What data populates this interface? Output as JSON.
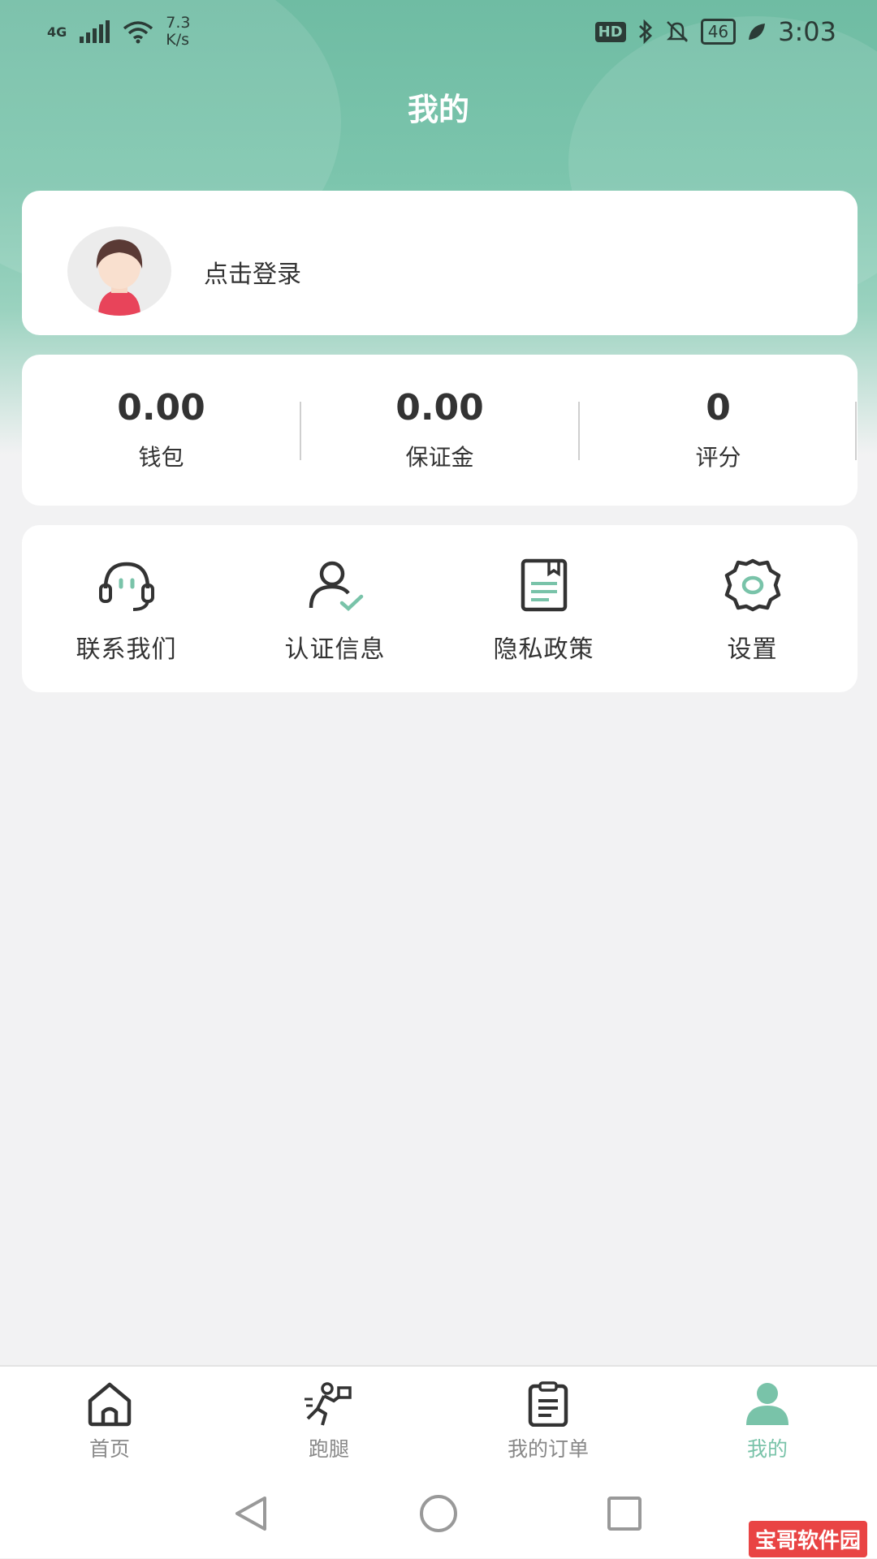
{
  "status_bar": {
    "network": "4G",
    "speed_value": "7.3",
    "speed_unit": "K/s",
    "hd_badge": "HD",
    "battery": "46",
    "time": "3:03"
  },
  "header": {
    "title": "我的"
  },
  "profile": {
    "login_label": "点击登录"
  },
  "stats": [
    {
      "value": "0.00",
      "label": "钱包"
    },
    {
      "value": "0.00",
      "label": "保证金"
    },
    {
      "value": "0",
      "label": "评分"
    }
  ],
  "menu": [
    {
      "label": "联系我们",
      "icon": "headset-icon"
    },
    {
      "label": "认证信息",
      "icon": "user-check-icon"
    },
    {
      "label": "隐私政策",
      "icon": "document-icon"
    },
    {
      "label": "设置",
      "icon": "gear-icon"
    }
  ],
  "tabs": [
    {
      "label": "首页",
      "icon": "home-icon"
    },
    {
      "label": "跑腿",
      "icon": "runner-icon"
    },
    {
      "label": "我的订单",
      "icon": "clipboard-icon"
    },
    {
      "label": "我的",
      "icon": "person-icon",
      "active": true
    }
  ],
  "watermark": "宝哥软件园",
  "colors": {
    "accent": "#79c3a9",
    "header": "#6fbca3",
    "avatar_shirt": "#e8445a"
  }
}
